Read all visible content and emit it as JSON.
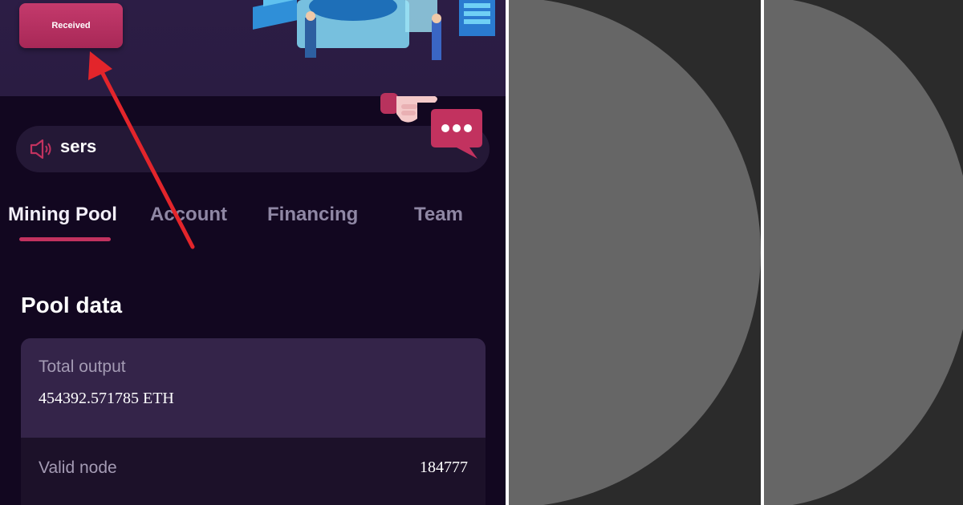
{
  "header": {
    "received_label": "Received"
  },
  "notice": {
    "text": "sers"
  },
  "tabs": [
    {
      "label": "Mining Pool",
      "active": true
    },
    {
      "label": "Account",
      "active": false
    },
    {
      "label": "Financing",
      "active": false
    },
    {
      "label": "Team",
      "active": false
    }
  ],
  "pool": {
    "title": "Pool data",
    "total_output_label": "Total output",
    "total_output_value": "454392.571785 ETH",
    "rows": [
      {
        "label": "Valid node",
        "value": "184777"
      }
    ]
  },
  "colors": {
    "accent": "#c2325f",
    "background": "#120720",
    "arrow": "#e3252b",
    "thumb_bg": "#2b2b2b",
    "thumb_circle": "#666666"
  },
  "icons": [
    "speaker-icon",
    "pointing-hand-icon",
    "chat-more-icon"
  ]
}
